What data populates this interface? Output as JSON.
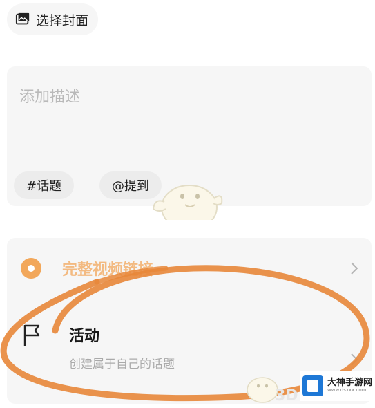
{
  "cover": {
    "label": "选择封面",
    "icon": "image-icon"
  },
  "description": {
    "placeholder": "添加描述"
  },
  "chips": {
    "topic": "#话题",
    "mention": "@提到"
  },
  "link_row": {
    "label": "完整视频链接",
    "icon": "link-dot-icon"
  },
  "activity_row": {
    "title": "活动",
    "subtitle": "创建属于自己的话题",
    "icon": "flag-icon"
  },
  "watermark": {
    "name": "大神手游网",
    "url": "www.dsxxx.com",
    "badge": "3D"
  },
  "colors": {
    "accent": "#f2a75a",
    "annotation": "#e8873a",
    "background": "#f6f6f6"
  }
}
